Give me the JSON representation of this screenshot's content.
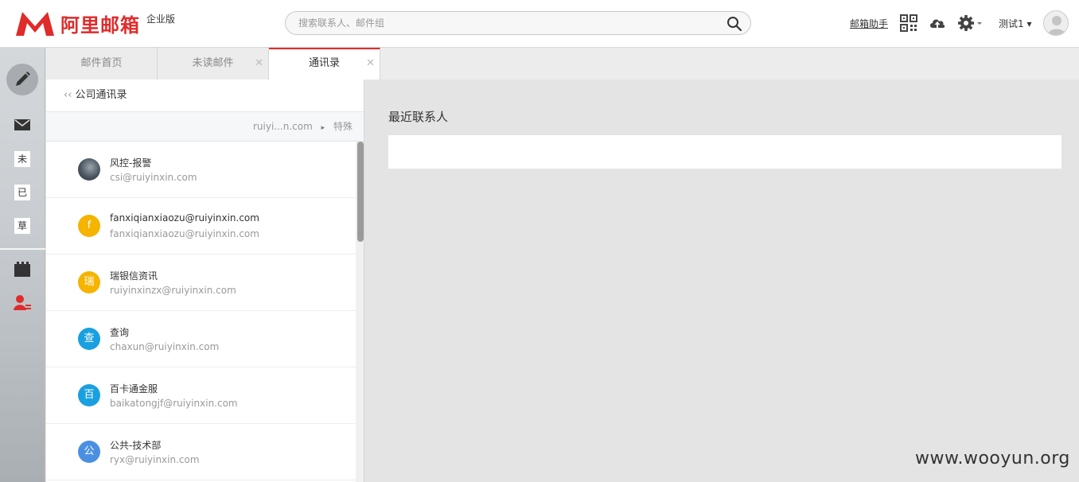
{
  "header": {
    "logo_text": "阿里邮箱",
    "edition": "企业版",
    "search_placeholder": "搜索联系人、邮件组",
    "helper_link": "邮箱助手",
    "user_name": "测试1 ▾",
    "icons": [
      "qr-code-icon",
      "cloud-upload-icon",
      "gear-icon"
    ]
  },
  "sidebar": {
    "compose_icon": "pencil-icon",
    "items": [
      {
        "type": "icon",
        "name": "mail-icon"
      },
      {
        "type": "box",
        "label": "未"
      },
      {
        "type": "box",
        "label": "已"
      },
      {
        "type": "box",
        "label": "草"
      },
      {
        "type": "icon",
        "name": "calendar-icon"
      },
      {
        "type": "icon",
        "name": "contacts-icon"
      }
    ]
  },
  "tabs": [
    {
      "label": "邮件首页",
      "closable": false,
      "active": false
    },
    {
      "label": "未读邮件",
      "closable": true,
      "active": false
    },
    {
      "label": "通讯录",
      "closable": true,
      "active": true
    }
  ],
  "panel": {
    "title": "公司通讯录",
    "back_glyph": "‹‹",
    "crumb_domain": "ruiyi...n.com",
    "crumb_sep": "▸",
    "crumb_group": "特殊"
  },
  "contacts": [
    {
      "name": "风控-报警",
      "email": "csi@ruiyinxin.com",
      "initial": "",
      "color": "#4a5560",
      "photo": true
    },
    {
      "name": "fanxiqianxiaozu@ruiyinxin.com",
      "email": "fanxiqianxiaozu@ruiyinxin.com",
      "initial": "f",
      "color": "#f5b400"
    },
    {
      "name": "瑞银信资讯",
      "email": "ruiyinxinzx@ruiyinxin.com",
      "initial": "瑞",
      "color": "#f5b400"
    },
    {
      "name": "查询",
      "email": "chaxun@ruiyinxin.com",
      "initial": "查",
      "color": "#1aa0e0"
    },
    {
      "name": "百卡通金服",
      "email": "baikatongjf@ruiyinxin.com",
      "initial": "百",
      "color": "#1aa0e0"
    },
    {
      "name": "公共-技术部",
      "email": "ryx@ruiyinxin.com",
      "initial": "公",
      "color": "#4a90e2"
    }
  ],
  "main": {
    "recent_title": "最近联系人"
  },
  "watermark": "www.wooyun.org",
  "colors": {
    "brand": "#e02b2b",
    "accent_yellow": "#f5b400",
    "accent_blue": "#1aa0e0"
  }
}
